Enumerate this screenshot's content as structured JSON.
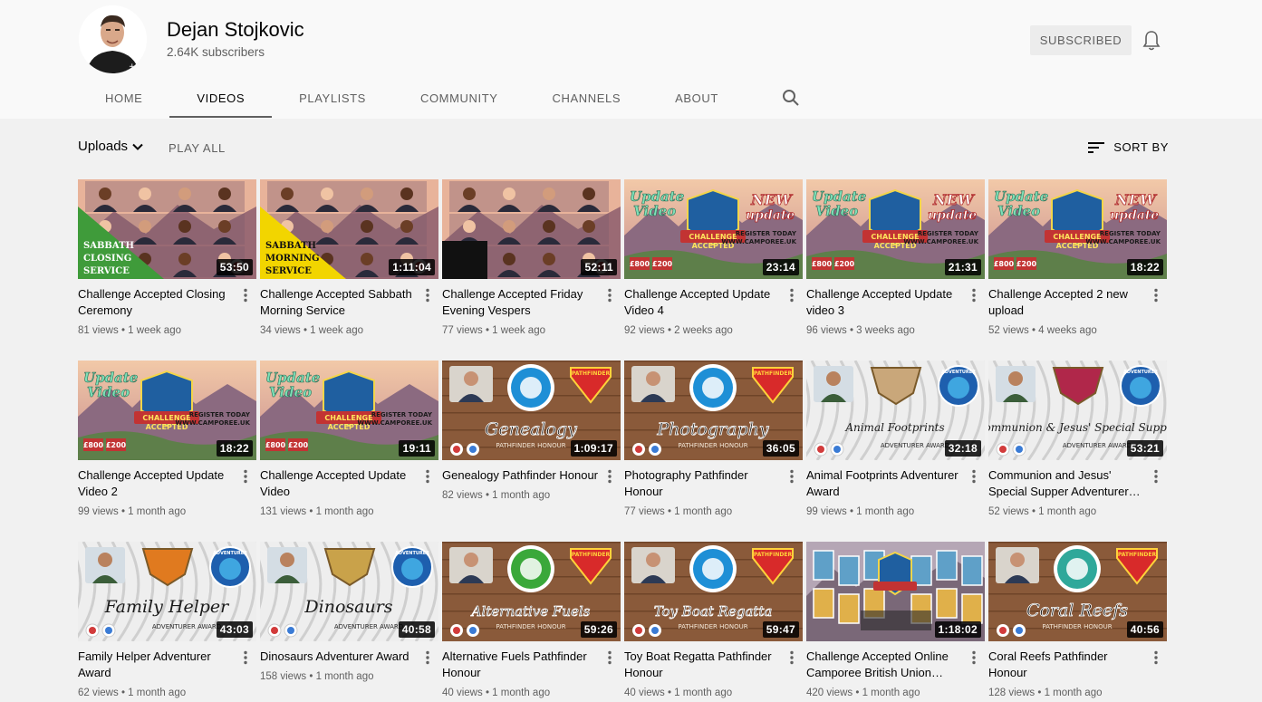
{
  "channel": {
    "name": "Dejan Stojkovic",
    "subscribers": "2.64K subscribers",
    "subscribe_label": "SUBSCRIBED"
  },
  "tabs": [
    {
      "label": "HOME"
    },
    {
      "label": "VIDEOS",
      "active": true
    },
    {
      "label": "PLAYLISTS"
    },
    {
      "label": "COMMUNITY"
    },
    {
      "label": "CHANNELS"
    },
    {
      "label": "ABOUT"
    }
  ],
  "filters": {
    "uploads_label": "Uploads",
    "play_all_label": "PLAY ALL",
    "sort_label": "SORT BY"
  },
  "videos": [
    {
      "title": "Challenge Accepted Closing Ceremony",
      "views": "81 views",
      "age": "1 week ago",
      "duration": "53:50",
      "thumb": "zoom-green",
      "banner": [
        "SABBATH",
        "CLOSING",
        "SERVICE"
      ],
      "accent": "#3f9b3a"
    },
    {
      "title": "Challenge Accepted Sabbath Morning Service",
      "views": "34 views",
      "age": "1 week ago",
      "duration": "1:11:04",
      "thumb": "zoom-yellow",
      "banner": [
        "SABBATH",
        "MORNING",
        "SERVICE"
      ],
      "accent": "#f2d500"
    },
    {
      "title": "Challenge Accepted Friday Evening Vespers",
      "views": "77 views",
      "age": "1 week ago",
      "duration": "52:11",
      "thumb": "zoom-plain"
    },
    {
      "title": "Challenge Accepted Update Video 4",
      "views": "92 views",
      "age": "2 weeks ago",
      "duration": "23:14",
      "thumb": "update-new",
      "overlay_a": "Update Video",
      "overlay_b": "NEW update",
      "promo": "REGISTER TODAY",
      "site": "WWW.CAMPOREE.UK"
    },
    {
      "title": "Challenge Accepted Update video 3",
      "views": "96 views",
      "age": "3 weeks ago",
      "duration": "21:31",
      "thumb": "update-new",
      "overlay_a": "Update Video",
      "overlay_b": "NEW update",
      "promo": "REGISTER TODAY",
      "site": "WWW.CAMPOREE.UK"
    },
    {
      "title": "Challenge Accepted 2 new upload",
      "views": "52 views",
      "age": "4 weeks ago",
      "duration": "18:22",
      "thumb": "update-new",
      "overlay_a": "Update Video",
      "overlay_b": "NEW update",
      "promo": "REGISTER TODAY",
      "site": "WWW.CAMPOREE.UK"
    },
    {
      "title": "Challenge Accepted Update Video 2",
      "views": "99 views",
      "age": "1 month ago",
      "duration": "18:22",
      "thumb": "update",
      "overlay_a": "Update Video",
      "promo": "REGISTER TODAY",
      "site": "WWW.CAMPOREE.UK"
    },
    {
      "title": "Challenge Accepted Update Video",
      "views": "131 views",
      "age": "1 month ago",
      "duration": "19:11",
      "thumb": "update",
      "overlay_a": "Update Video",
      "promo": "REGISTER TODAY",
      "site": "WWW.CAMPOREE.UK"
    },
    {
      "title": "Genealogy Pathfinder Honour",
      "views": "82 views",
      "age": "1 month ago",
      "duration": "1:09:17",
      "thumb": "pathfinder",
      "script": "Genealogy",
      "sub": "PATHFINDER HONOUR",
      "badge": "#1e8fd6"
    },
    {
      "title": "Photography Pathfinder Honour",
      "views": "77 views",
      "age": "1 month ago",
      "duration": "36:05",
      "thumb": "pathfinder",
      "script": "Photography",
      "sub": "PATHFINDER HONOUR",
      "badge": "#1e8fd6"
    },
    {
      "title": "Animal Footprints Adventurer Award",
      "views": "99 views",
      "age": "1 month ago",
      "duration": "32:18",
      "thumb": "adventurer",
      "script": "Animal Footprints",
      "sub": "ADVENTURER AWARD",
      "badge": "#c9a77a"
    },
    {
      "title": "Communion and Jesus' Special Supper Adventurer Award",
      "views": "52 views",
      "age": "1 month ago",
      "duration": "53:21",
      "thumb": "adventurer",
      "script": "Communion & Jesus' Special Supper",
      "sub": "ADVENTURER AWARD",
      "badge": "#b0274a"
    },
    {
      "title": "Family Helper Adventurer Award",
      "views": "62 views",
      "age": "1 month ago",
      "duration": "43:03",
      "thumb": "adventurer",
      "script": "Family Helper",
      "sub": "ADVENTURER AWARD",
      "badge": "#e07a1f"
    },
    {
      "title": "Dinosaurs Adventurer Award",
      "views": "158 views",
      "age": "1 month ago",
      "duration": "40:58",
      "thumb": "adventurer",
      "script": "Dinosaurs",
      "sub": "ADVENTURER AWARD",
      "badge": "#c9a24a"
    },
    {
      "title": "Alternative Fuels Pathfinder Honour",
      "views": "40 views",
      "age": "1 month ago",
      "duration": "59:26",
      "thumb": "pathfinder",
      "script": "Alternative Fuels",
      "sub": "PATHFINDER HONOUR",
      "badge": "#3aa83a"
    },
    {
      "title": "Toy Boat Regatta Pathfinder Honour",
      "views": "40 views",
      "age": "1 month ago",
      "duration": "59:47",
      "thumb": "pathfinder",
      "script": "Toy Boat Regatta",
      "sub": "PATHFINDER HONOUR",
      "badge": "#1e8fd6"
    },
    {
      "title": "Challenge Accepted Online Camporee British Union Conference Live",
      "views": "420 views",
      "age": "1 month ago",
      "duration": "1:18:02",
      "thumb": "camporee"
    },
    {
      "title": "Coral Reefs Pathfinder Honour",
      "views": "128 views",
      "age": "1 month ago",
      "duration": "40:56",
      "thumb": "pathfinder",
      "script": "Coral Reefs",
      "sub": "PATHFINDER HONOUR",
      "badge": "#2fa89a"
    }
  ],
  "colors": {
    "page_bg": "#f9f9f9",
    "content_bg": "#f1f1f1",
    "muted_text": "#606060",
    "primary_text": "#030303"
  }
}
